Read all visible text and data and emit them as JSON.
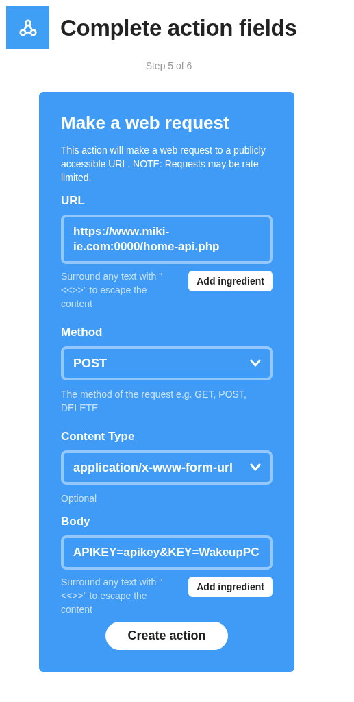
{
  "header": {
    "title": "Complete action fields",
    "step": "Step 5 of 6"
  },
  "card": {
    "title": "Make a web request",
    "description": "This action will make a web request to a publicly accessible URL. NOTE: Requests may be rate limited.",
    "fields": [
      {
        "kind": "text",
        "label": "URL",
        "value": "https://www.miki-ie.com:0000/home-api.php",
        "help": "Surround any text with \"<<>>\" to escape the content",
        "button": "Add ingredient"
      },
      {
        "kind": "select",
        "label": "Method",
        "value": "POST",
        "help": "The method of the request e.g. GET, POST, DELETE"
      },
      {
        "kind": "select",
        "label": "Content Type",
        "value": "application/x-www-form-url",
        "help": "Optional"
      },
      {
        "kind": "text",
        "label": "Body",
        "value": "APIKEY=apikey&KEY=WakeupPC",
        "help": "Surround any text with \"<<>>\" to escape the content",
        "button": "Add ingredient"
      }
    ],
    "submit": "Create action"
  }
}
